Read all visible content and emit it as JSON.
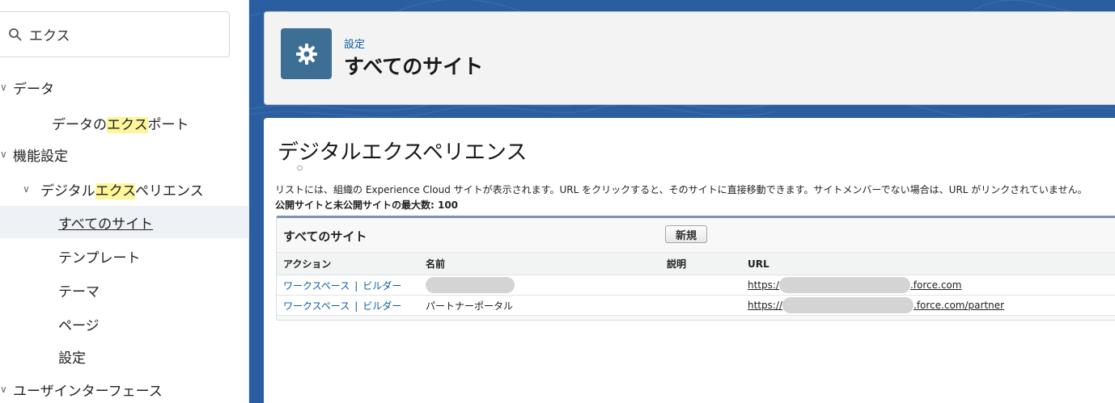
{
  "search": {
    "value": "エクス"
  },
  "sidebar": {
    "items": [
      {
        "label": "データ"
      },
      {
        "label_pre": "データの",
        "label_hl": "エクス",
        "label_post": "ポート"
      },
      {
        "label": "機能設定"
      },
      {
        "label_pre": "デジタル",
        "label_hl": "エクス",
        "label_post": "ペリエンス"
      },
      {
        "label": "すべてのサイト"
      },
      {
        "label": "テンプレート"
      },
      {
        "label": "テーマ"
      },
      {
        "label": "ページ"
      },
      {
        "label": "設定"
      },
      {
        "label": "ユーザインターフェース"
      }
    ]
  },
  "header": {
    "breadcrumb": "設定",
    "title": "すべてのサイト",
    "icon": "gear-icon"
  },
  "content": {
    "section_title": "デジタルエクスペリエンス",
    "dot": "○",
    "description": "リストには、組織の Experience Cloud サイトが表示されます。URL をクリックすると、そのサイトに直接移動できます。サイトメンバーでない場合は、URL がリンクされていません。",
    "max_sites": "公開サイトと未公開サイトの最大数: 100",
    "list": {
      "title": "すべてのサイト",
      "new_button": "新規",
      "columns": [
        "アクション",
        "名前",
        "説明",
        "URL"
      ],
      "rows": [
        {
          "workspace": "ワークスペース",
          "sep": "|",
          "builder": "ビルダー",
          "name": "",
          "description": "",
          "url_prefix": "https:/",
          "url_suffix": ".force.com"
        },
        {
          "workspace": "ワークスペース",
          "sep": "|",
          "builder": "ビルダー",
          "name": "パートナーポータル",
          "description": "",
          "url_prefix": "https://",
          "url_suffix": ".force.com/partner"
        }
      ]
    }
  },
  "colors": {
    "brand_blue": "#2a5ea0",
    "link": "#0b5cab",
    "highlight": "#fff59a",
    "gear_bg": "#3d6f95"
  }
}
